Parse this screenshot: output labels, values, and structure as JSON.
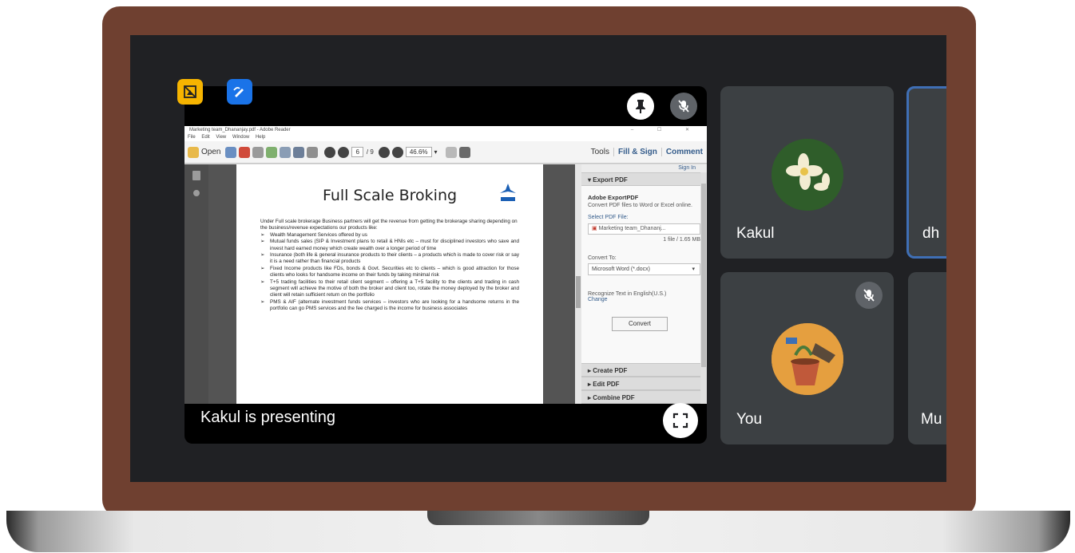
{
  "meeting": {
    "presenting_label": "Kakul is presenting",
    "participants": [
      {
        "name": "Kakul"
      },
      {
        "name": "dh"
      },
      {
        "name": "You"
      },
      {
        "name": "Mu"
      }
    ]
  },
  "adobe": {
    "window_title": "Marketing team_Dhananjay.pdf - Adobe Reader",
    "window_controls": "– ☐ ✕",
    "menu": [
      "File",
      "Edit",
      "View",
      "Window",
      "Help"
    ],
    "toolbar": {
      "open_label": "Open",
      "page_current": "6",
      "page_total": "/ 9",
      "zoom": "46.6%",
      "tools_label": "Tools",
      "fill_sign_label": "Fill & Sign",
      "comment_label": "Comment"
    },
    "document": {
      "title": "Full Scale Broking",
      "intro": "Under Full scale brokerage Business partners will get the revenue from getting the brokerage sharing depending on the business/revenue expectations our products like:",
      "bullets": [
        "Wealth Management Services offered by us",
        "Mutual funds sales (SIP & Investment plans to retail & HNIs etc – must for disciplined investors who save and invest hard earned money which create wealth over a longer period of time",
        "Insurance (both life & general insurance products to their clients – a products which is made to cover risk or say it is a need rather than financial products",
        "Fixed Income products like FDs, bonds & Govt. Securities etc to clients – which is good attraction for those clients who looks for handsome income on their funds by taking minimal risk",
        "T+5 trading facilities to their retail client segment – offering a T+5 facility to the clients and trading in cash segment will achieve the motive of both the broker and client too, rotate the money deployed by the broker and client will retain sufficient return on the portfolio",
        "PMS & AIF (alternate investment funds services – investors who are looking for a handsome returns in the portfolio can go PMS services and the fee charged is the income for business associates"
      ]
    },
    "right_pane": {
      "sign_in": "Sign In",
      "export_header": "▾  Export PDF",
      "export_title": "Adobe ExportPDF",
      "export_desc": "Convert PDF files to Word or Excel online.",
      "select_file_label": "Select PDF File:",
      "file_name": "Marketing team_Dhananj...",
      "file_size": "1 file / 1.65 MB",
      "convert_to_label": "Convert To:",
      "convert_to_value": "Microsoft Word (*.docx)",
      "recognize_text": "Recognize Text in English(U.S.)",
      "change_link": "Change",
      "convert_button": "Convert",
      "sections": [
        "▸  Create PDF",
        "▸  Edit PDF",
        "▸  Combine PDF"
      ]
    }
  }
}
